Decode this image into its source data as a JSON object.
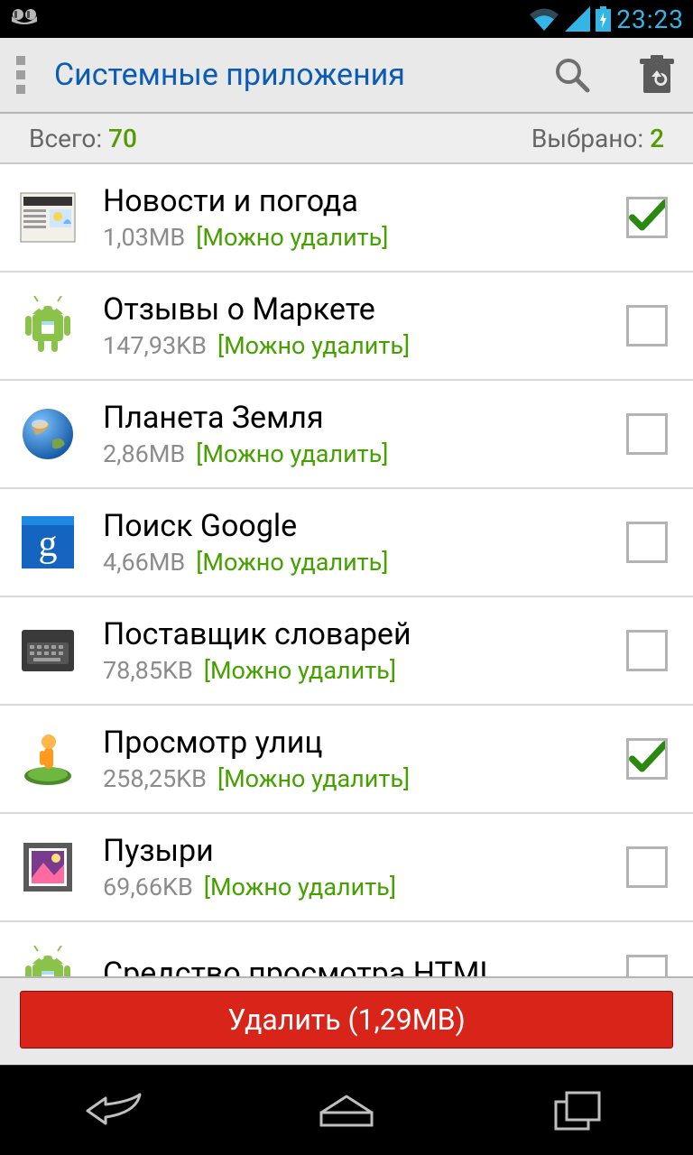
{
  "status": {
    "time": "23:23"
  },
  "header": {
    "title": "Системные приложения"
  },
  "summary": {
    "total_label": "Всего:",
    "total_value": "70",
    "selected_label": "Выбрано:",
    "selected_value": "2"
  },
  "apps": [
    {
      "name": "Новости и погода",
      "size": "1,03MB",
      "hint": "[Можно удалить]",
      "checked": true,
      "icon": "news"
    },
    {
      "name": "Отзывы о Маркете",
      "size": "147,93KB",
      "hint": "[Можно удалить]",
      "checked": false,
      "icon": "android"
    },
    {
      "name": "Планета Земля",
      "size": "2,86MB",
      "hint": "[Можно удалить]",
      "checked": false,
      "icon": "earth"
    },
    {
      "name": "Поиск Google",
      "size": "4,66MB",
      "hint": "[Можно удалить]",
      "checked": false,
      "icon": "google"
    },
    {
      "name": "Поставщик словарей",
      "size": "78,85KB",
      "hint": "[Можно удалить]",
      "checked": false,
      "icon": "keyboard"
    },
    {
      "name": "Просмотр улиц",
      "size": "258,25KB",
      "hint": "[Можно удалить]",
      "checked": true,
      "icon": "street"
    },
    {
      "name": "Пузыри",
      "size": "69,66KB",
      "hint": "[Можно удалить]",
      "checked": false,
      "icon": "gallery"
    },
    {
      "name": "Средство просмотра HTML",
      "size": "",
      "hint": "",
      "checked": false,
      "icon": "android"
    }
  ],
  "delete_button": {
    "label": "Удалить (1,29MB)"
  }
}
